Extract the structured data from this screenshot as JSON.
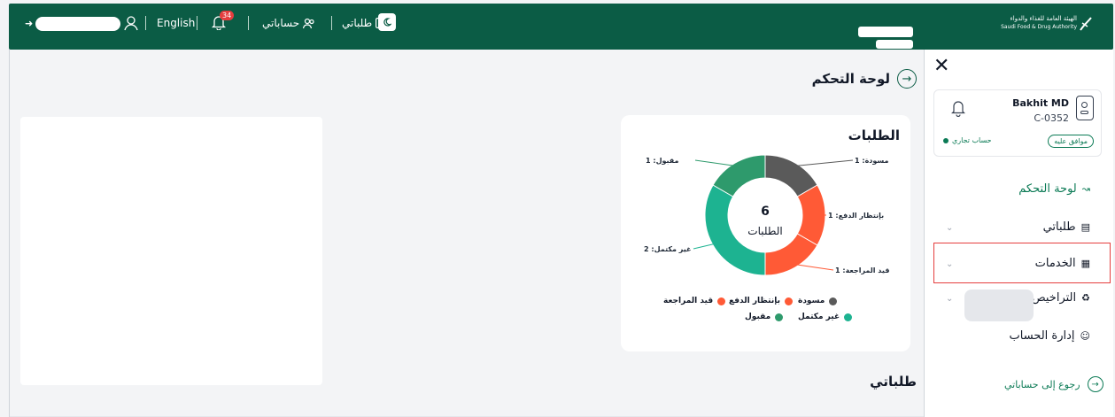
{
  "header": {
    "logo_text_ar": "الهيئة العامة للغذاء والدواء",
    "logo_text_en": "Saudi Food & Drug Authority",
    "theme_toggle_icon": "moon-icon",
    "my_requests_label": "طلباتي",
    "my_accounts_label": "حساباتي",
    "notification_count": "34",
    "language_label": "English",
    "user_icon": "user-icon",
    "logout_icon": "logout-icon"
  },
  "page": {
    "title": "لوحة التحكم",
    "section_my_requests": "طلباتي"
  },
  "requests_card": {
    "title": "الطلبات",
    "total": "6",
    "total_label": "الطلبات",
    "slice_labels": {
      "draft": "مسودة: 1",
      "awaiting_payment": "بإنتظار الدفع: 1",
      "under_review": "قيد المراجعة: 1",
      "incomplete": "غير مكتمل: 2",
      "accepted": "مقبول: 1"
    },
    "legend": {
      "draft": "مسودة",
      "awaiting_payment": "بإنتظار الدفع",
      "under_review": "قيد المراجعة",
      "incomplete": "غير مكتمل",
      "accepted": "مقبول"
    }
  },
  "chart_data": {
    "type": "pie",
    "title": "الطلبات",
    "center_value": 6,
    "center_label": "الطلبات",
    "slices": [
      {
        "name": "مسودة",
        "value": 1,
        "color": "#5a5a5a"
      },
      {
        "name": "بإنتظار الدفع",
        "value": 1,
        "color": "#ff5a36"
      },
      {
        "name": "قيد المراجعة",
        "value": 1,
        "color": "#ff5a36"
      },
      {
        "name": "غير مكتمل",
        "value": 2,
        "color": "#1db391"
      },
      {
        "name": "مقبول",
        "value": 1,
        "color": "#2e9a6c"
      }
    ]
  },
  "sidebar": {
    "user_name": "Bakhit MD",
    "user_code": "C-0352",
    "approved_badge": "موافق عليه",
    "account_type": "حساب تجاري",
    "items": [
      {
        "label": "لوحة التحكم",
        "icon": "chart-line-icon"
      },
      {
        "label": "طلباتي",
        "icon": "list-icon"
      },
      {
        "label": "الخدمات",
        "icon": "grid-icon"
      },
      {
        "label": "التراخيص",
        "icon": "license-icon"
      },
      {
        "label": "إدارة الحساب",
        "icon": "user-icon"
      }
    ],
    "back_label": "رجوع إلى حساباتي"
  },
  "colors": {
    "brand": "#0b5c45",
    "accent": "#0b7a55",
    "draft": "#5a5a5a",
    "orange": "#ff5a36",
    "teal": "#1db391",
    "green": "#2e9a6c",
    "highlight_border": "#e53e3e"
  }
}
